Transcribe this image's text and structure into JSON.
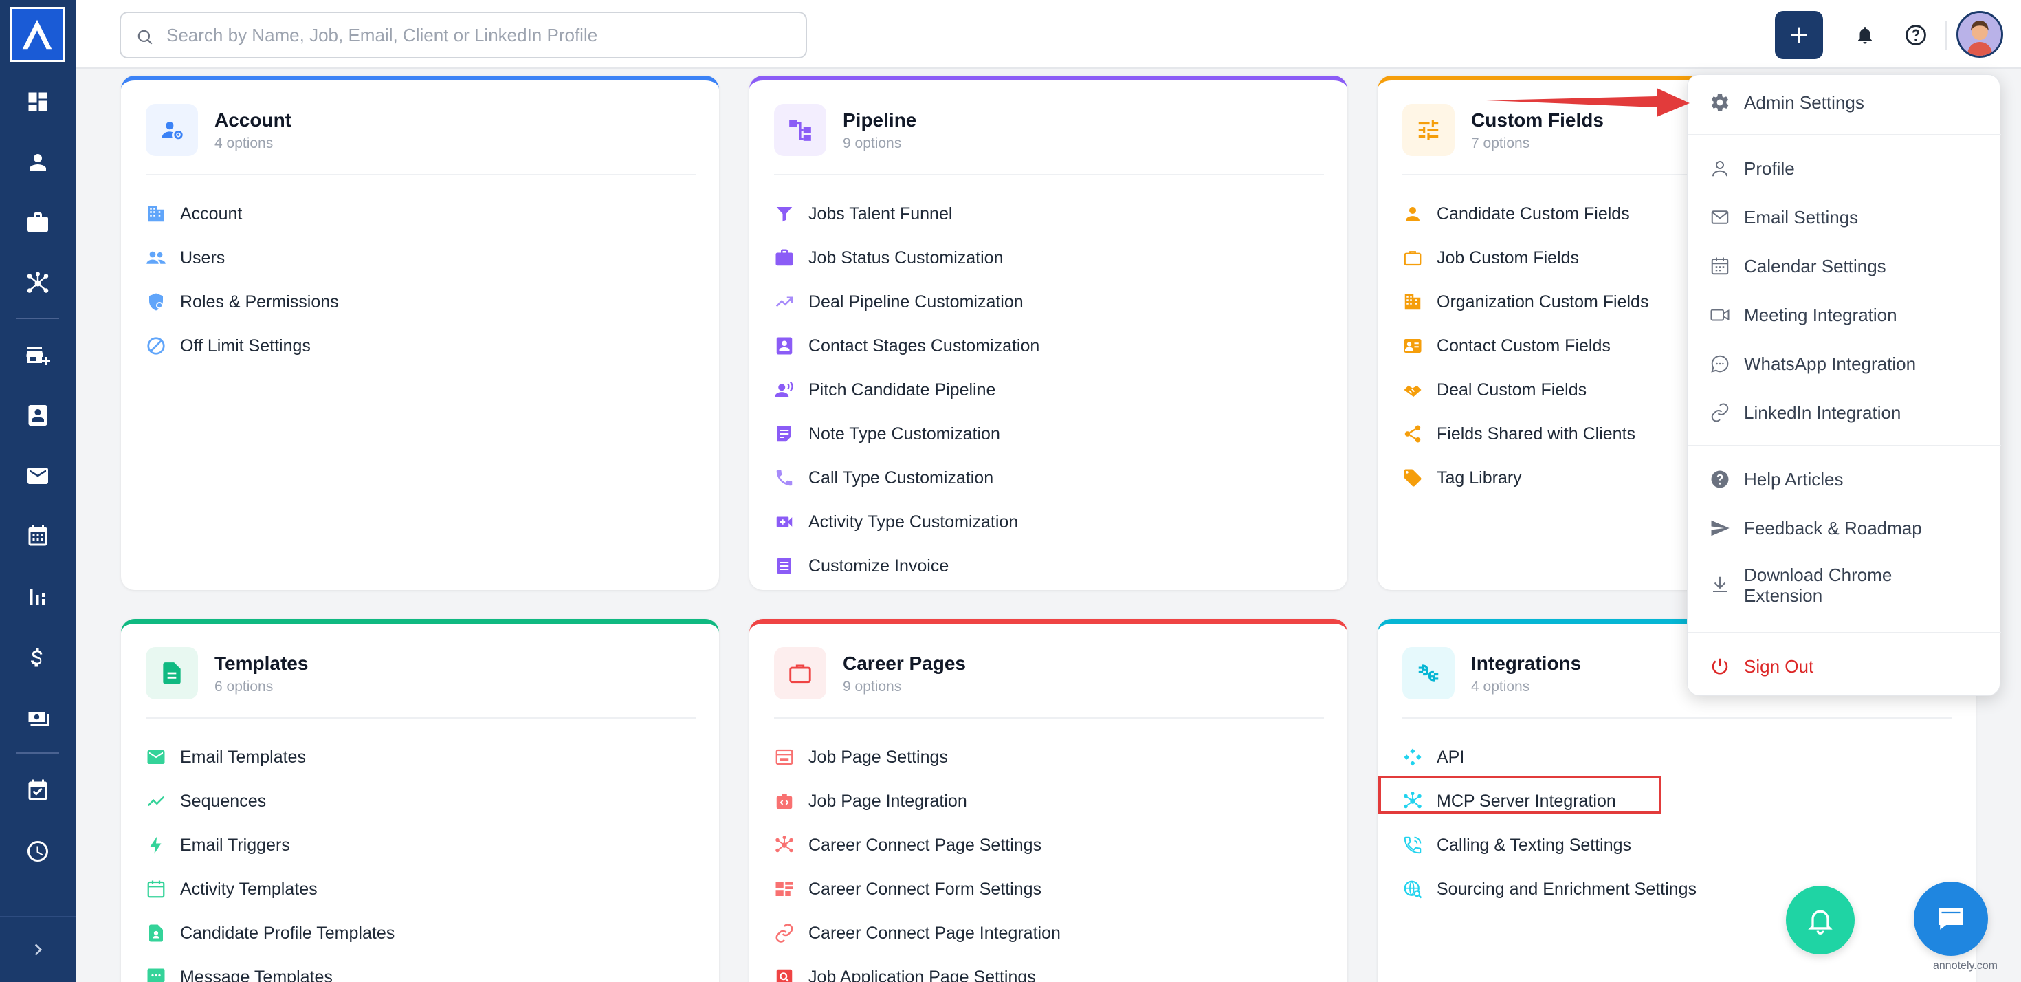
{
  "search": {
    "placeholder": "Search by Name, Job, Email, Client or LinkedIn Profile",
    "value": ""
  },
  "cards": [
    {
      "title": "Account",
      "subtitle": "4 options",
      "accent": "#3b82f6",
      "items": [
        "Account",
        "Users",
        "Roles & Permissions",
        "Off Limit Settings"
      ]
    },
    {
      "title": "Pipeline",
      "subtitle": "9 options",
      "accent": "#8b5cf6",
      "items": [
        "Jobs Talent Funnel",
        "Job Status Customization",
        "Deal Pipeline Customization",
        "Contact Stages Customization",
        "Pitch Candidate Pipeline",
        "Note Type Customization",
        "Call Type Customization",
        "Activity Type Customization",
        "Customize Invoice"
      ]
    },
    {
      "title": "Custom Fields",
      "subtitle": "7 options",
      "accent": "#f59e0b",
      "items": [
        "Candidate Custom Fields",
        "Job Custom Fields",
        "Organization Custom Fields",
        "Contact Custom Fields",
        "Deal Custom Fields",
        "Fields Shared with Clients",
        "Tag Library"
      ]
    },
    {
      "title": "Templates",
      "subtitle": "6 options",
      "accent": "#10b981",
      "items": [
        "Email Templates",
        "Sequences",
        "Email Triggers",
        "Activity Templates",
        "Candidate Profile Templates",
        "Message Templates"
      ]
    },
    {
      "title": "Career Pages",
      "subtitle": "9 options",
      "accent": "#ef4444",
      "items": [
        "Job Page Settings",
        "Job Page Integration",
        "Career Connect Page Settings",
        "Career Connect Form Settings",
        "Career Connect Page Integration",
        "Job Application Page Settings"
      ]
    },
    {
      "title": "Integrations",
      "subtitle": "4 options",
      "accent": "#06b6d4",
      "items": [
        "API",
        "MCP Server Integration",
        "Calling & Texting Settings",
        "Sourcing and Enrichment Settings"
      ]
    }
  ],
  "dropdown": {
    "admin_settings": "Admin Settings",
    "profile": "Profile",
    "email_settings": "Email Settings",
    "calendar_settings": "Calendar Settings",
    "meeting_integration": "Meeting Integration",
    "whatsapp_integration": "WhatsApp Integration",
    "linkedin_integration": "LinkedIn Integration",
    "help_articles": "Help Articles",
    "feedback_roadmap": "Feedback & Roadmap",
    "download_chrome": "Download Chrome Extension",
    "sign_out": "Sign Out"
  },
  "colors": {
    "sidebar": "#1b3a6b",
    "brand": "#1a5bd6",
    "highlight": "#e23b3b",
    "sign_out": "#dc2626"
  },
  "watermark": "annotely.com"
}
